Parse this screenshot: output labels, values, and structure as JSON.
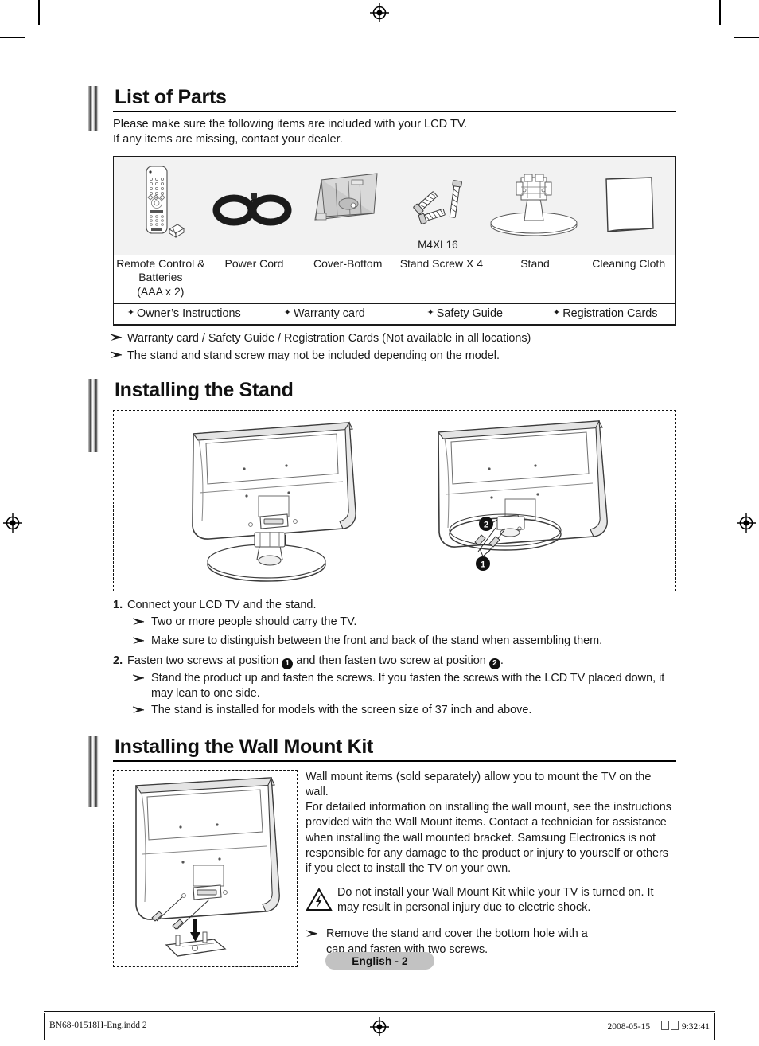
{
  "document": {
    "page_badge": "English - 2",
    "footer": {
      "file": "BN68-01518H-Eng.indd   2",
      "date": "2008-05-15",
      "time": "9:32:41"
    }
  },
  "sections": [
    {
      "id": "list-of-parts",
      "title": "List of Parts",
      "intro_line1": "Please make sure the following items are included with your LCD TV.",
      "intro_line2": "If any items are missing, contact your dealer.",
      "parts": [
        {
          "icon": "remote-control-icon",
          "label": "Remote Control &\nBatteries\n(AAA x 2)",
          "code": ""
        },
        {
          "icon": "power-cord-icon",
          "label": "Power Cord",
          "code": ""
        },
        {
          "icon": "cover-bottom-icon",
          "label": "Cover-Bottom",
          "code": ""
        },
        {
          "icon": "stand-screw-icon",
          "label": "Stand Screw X 4",
          "code": "M4XL16"
        },
        {
          "icon": "stand-icon",
          "label": "Stand",
          "code": ""
        },
        {
          "icon": "cleaning-cloth-icon",
          "label": "Cleaning Cloth",
          "code": ""
        }
      ],
      "documents": [
        "Owner’s Instructions",
        "Warranty card",
        "Safety Guide",
        "Registration Cards"
      ],
      "notes": [
        "Warranty card / Safety Guide / Registration Cards (Not available in all locations)",
        "The stand and stand screw may not be included depending on the model."
      ]
    },
    {
      "id": "installing-the-stand",
      "title": "Installing the Stand",
      "steps": [
        {
          "num": "1.",
          "text": "Connect your LCD TV and the stand.",
          "notes": [
            "Two or more people should carry the TV.",
            "Make sure to distinguish between the front and back of the stand when assembling them."
          ]
        },
        {
          "num": "2.",
          "text_a": "Fasten two screws at position ",
          "marker_1": "1",
          "text_b": " and then fasten two screw at position ",
          "marker_2": "2",
          "text_c": ".",
          "notes": [
            "Stand the product up and fasten the screws. If you fasten the screws with the LCD TV placed down, it may lean to one side.",
            "The stand is installed for models with the screen size of 37 inch and above."
          ]
        }
      ],
      "figure_markers": [
        "1",
        "2"
      ]
    },
    {
      "id": "installing-the-wall-mount-kit",
      "title": "Installing the Wall Mount Kit",
      "body": "Wall mount items (sold separately) allow you to mount the TV on the wall.\nFor detailed information on installing the wall mount, see the instructions provided with the Wall Mount items. Contact a technician for assistance when installing the wall mounted bracket. Samsung Electronics is not responsible for any damage to the product or injury to yourself or others if you elect to install the TV on your own.",
      "warning_icon": "electric-shock-warning-icon",
      "warning": "Do not install your Wall Mount Kit while your TV is turned on. It may result in personal injury due to electric shock.",
      "note": "Remove the stand and cover the bottom hole with a cap and fasten with two screws."
    }
  ],
  "colors": {
    "heading_rule": "#000000",
    "parts_panel_bg": "#f2f2f2",
    "page_badge_bg": "#c2c2c2",
    "text": "#1a1a1a"
  }
}
